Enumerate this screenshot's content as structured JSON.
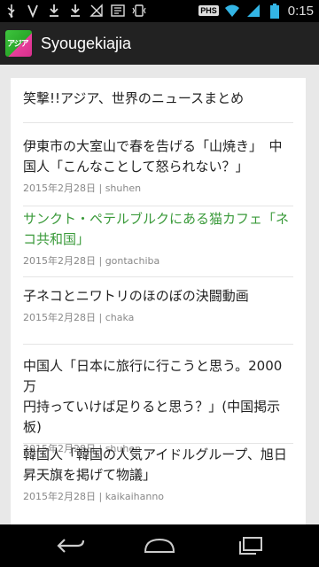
{
  "status_bar": {
    "icons": [
      "usb-icon",
      "voicemail-icon",
      "download-icon",
      "download-icon",
      "signal-off-icon",
      "app-icon",
      "vibrate-icon"
    ],
    "carrier": "PHS",
    "time": "0:15"
  },
  "action_bar": {
    "icon_text": "アジア",
    "title": "Syougekiajia"
  },
  "blog_title": "笑撃!!アジア、世界のニュースまとめ",
  "articles": [
    {
      "title_line1": "伊東市の大室山で春を告げる「山焼き」　中",
      "title_line2": "国人「こんなことして怒られない？」",
      "meta": "2015年2月28日 | shuhen",
      "visited": false
    },
    {
      "title_line1": "サンクト・ペテルブルクにある猫カフェ「ネ",
      "title_line2": "コ共和国」",
      "meta": "2015年2月28日 | gontachiba",
      "visited": true
    },
    {
      "title_line1": "子ネコとニワトリのほのぼの決闘動画",
      "meta": "2015年2月28日 | chaka",
      "visited": false
    },
    {
      "title_line1": "中国人「日本に旅行に行こうと思う。2000万",
      "title_line2": "円持っていけば足りると思う？」(中国掲示",
      "title_line3": "板)",
      "meta": "2015年2月28日 | shuhen",
      "visited": false
    },
    {
      "title_line1": "韓国人「韓国の人気アイドルグループ、旭日",
      "title_line2": "昇天旗を掲げて物議」",
      "meta": "2015年2月28日 | kaikaihanno",
      "visited": false
    }
  ],
  "colors": {
    "link_visited": "#3a9a3a",
    "text": "#222222",
    "meta": "#888888"
  }
}
